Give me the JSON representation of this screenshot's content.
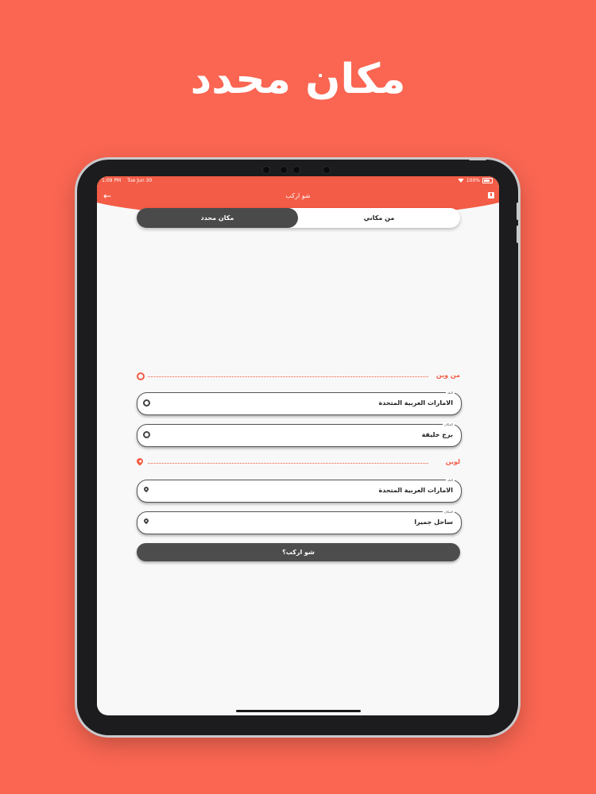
{
  "hero": {
    "title": "مكان محدد"
  },
  "status": {
    "time": "1:09 PM",
    "date": "Tue Jun 30",
    "battery": "100%"
  },
  "nav": {
    "back_icon": "arrow-left-icon",
    "title": "شو اركب",
    "flag_icon": "report-icon"
  },
  "segmented": {
    "active": "مكان محدد",
    "inactive": "من مكاني"
  },
  "from_section": {
    "label": "من وين",
    "country_label": "البلد",
    "country_value": "الامارات العربية المتحدة",
    "place_label": "المكان",
    "place_value": "برج خليفة"
  },
  "to_section": {
    "label": "لوين",
    "country_label": "البلد",
    "country_value": "الامارات العربية المتحدة",
    "place_label": "المكان",
    "place_value": "ساحل جميرا"
  },
  "submit": {
    "label": "شو اركب؟"
  },
  "colors": {
    "accent": "#f35c46",
    "background": "#fa6652",
    "dark": "#4a4a4a"
  }
}
